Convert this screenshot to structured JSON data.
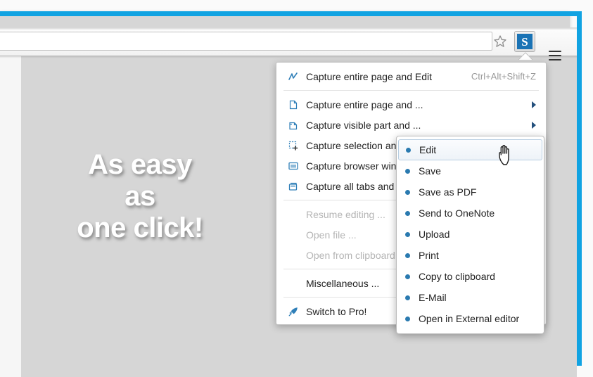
{
  "browser": {
    "omnibox_value": "",
    "star_icon": "bookmark-star-icon",
    "extension_icon_letter": "S",
    "extension_icon_color": "#1a73b5",
    "menu_icon": "hamburger-menu-icon",
    "frame_accent_color": "#11a3e2"
  },
  "page": {
    "promo_line1": "As easy",
    "promo_line2": "as",
    "promo_line3": "one click!",
    "background_color": "#d6d6d6"
  },
  "menu": {
    "items": [
      {
        "label": "Capture entire page and Edit",
        "shortcut": "Ctrl+Alt+Shift+Z",
        "icon": "pencil-edit-icon",
        "type": "item",
        "has_submenu": false,
        "disabled": false
      },
      {
        "type": "separator"
      },
      {
        "label": "Capture entire page and ...",
        "shortcut": "",
        "icon": "page-icon",
        "type": "item",
        "has_submenu": true,
        "disabled": false
      },
      {
        "label": "Capture visible part and ...",
        "shortcut": "",
        "icon": "page-folded-icon",
        "type": "item",
        "has_submenu": true,
        "disabled": false
      },
      {
        "label": "Capture selection and ...",
        "shortcut": "",
        "icon": "selection-add-icon",
        "type": "item",
        "has_submenu": true,
        "disabled": false
      },
      {
        "label": "Capture browser window and ...",
        "shortcut": "",
        "icon": "browser-window-icon",
        "type": "item",
        "has_submenu": true,
        "disabled": false
      },
      {
        "label": "Capture all tabs and ...",
        "shortcut": "",
        "icon": "tabs-icon",
        "type": "item",
        "has_submenu": true,
        "disabled": false
      },
      {
        "type": "separator"
      },
      {
        "label": "Resume editing ...",
        "shortcut": "",
        "icon": "",
        "type": "item",
        "has_submenu": false,
        "disabled": true
      },
      {
        "label": "Open file ...",
        "shortcut": "",
        "icon": "",
        "type": "item",
        "has_submenu": false,
        "disabled": true
      },
      {
        "label": "Open from clipboard ...",
        "shortcut": "",
        "icon": "",
        "type": "item",
        "has_submenu": false,
        "disabled": true
      },
      {
        "type": "separator"
      },
      {
        "label": "Miscellaneous ...",
        "shortcut": "",
        "icon": "",
        "type": "item",
        "has_submenu": false,
        "disabled": false
      },
      {
        "type": "separator"
      },
      {
        "label": "Switch to Pro!",
        "shortcut": "",
        "icon": "rocket-icon",
        "type": "item",
        "has_submenu": false,
        "disabled": false
      }
    ]
  },
  "submenu": {
    "items": [
      {
        "label": "Edit",
        "active": true
      },
      {
        "label": "Save",
        "active": false
      },
      {
        "label": "Save as PDF",
        "active": false
      },
      {
        "label": "Send to OneNote",
        "active": false
      },
      {
        "label": "Upload",
        "active": false
      },
      {
        "label": "Print",
        "active": false
      },
      {
        "label": "Copy to clipboard",
        "active": false
      },
      {
        "label": "E-Mail",
        "active": false
      },
      {
        "label": "Open in External editor",
        "active": false
      }
    ],
    "bullet_color": "#2a7ab0"
  },
  "cursor": {
    "type": "pointing-hand-cursor"
  }
}
